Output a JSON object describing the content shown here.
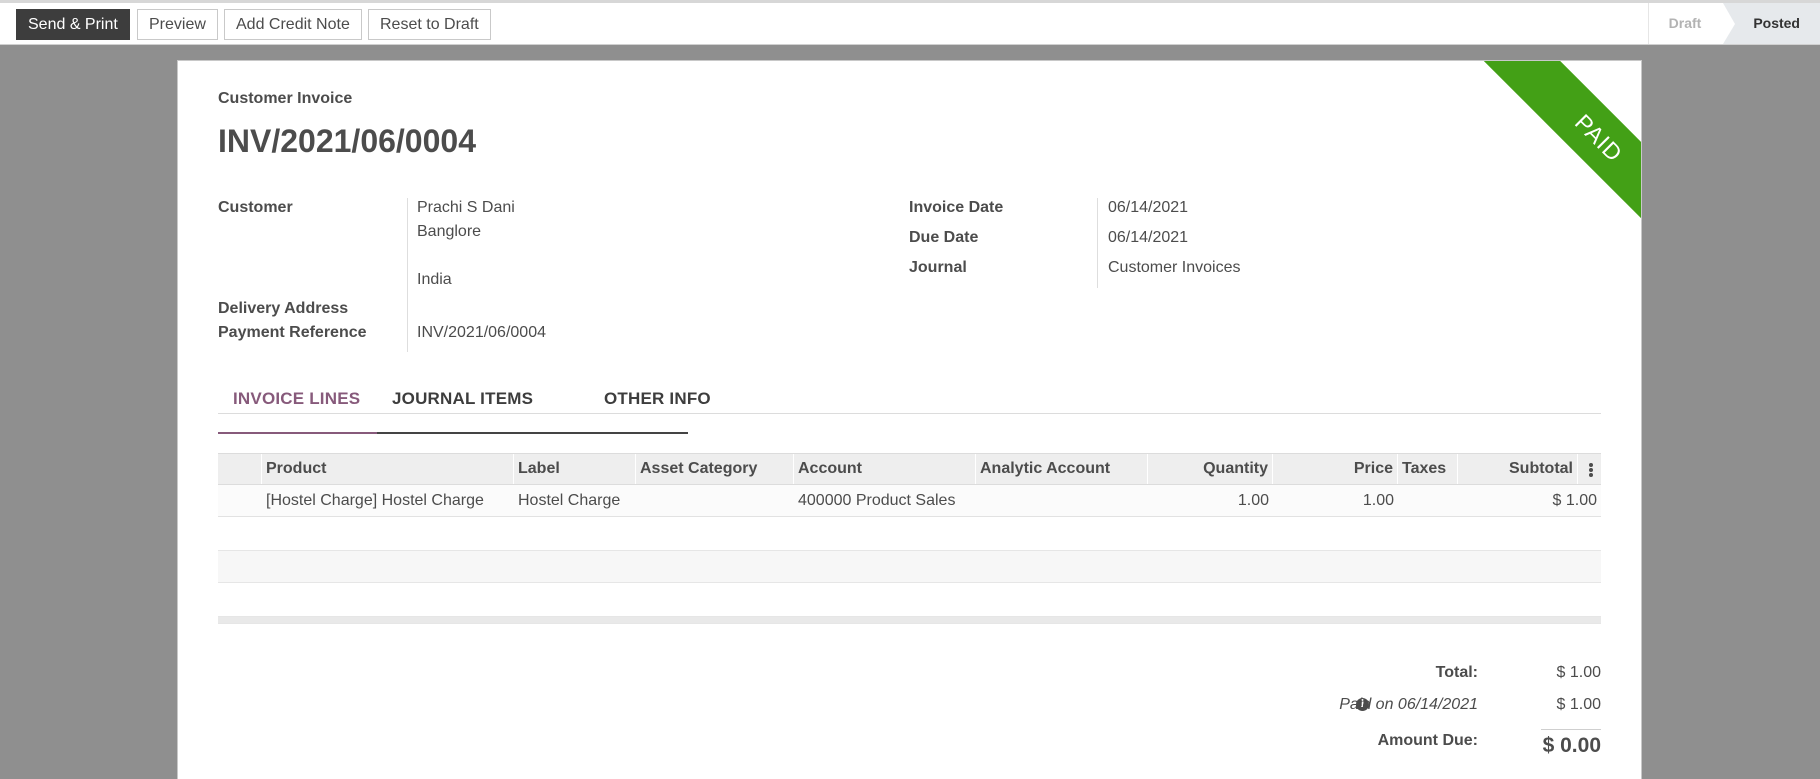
{
  "toolbar": {
    "send_print": "Send & Print",
    "preview": "Preview",
    "add_credit_note": "Add Credit Note",
    "reset_to_draft": "Reset to Draft"
  },
  "status": {
    "stages": [
      "Draft",
      "Posted"
    ],
    "current": "Posted"
  },
  "ribbon": {
    "text": "PAID",
    "color": "#43a016"
  },
  "invoice": {
    "kind": "Customer Invoice",
    "number": "INV/2021/06/0004",
    "customer_label": "Customer",
    "customer_name": "Prachi S Dani",
    "customer_city": "Banglore",
    "customer_country": "India",
    "delivery_address_label": "Delivery Address",
    "payment_reference_label": "Payment Reference",
    "payment_reference": "INV/2021/06/0004",
    "invoice_date_label": "Invoice Date",
    "invoice_date": "06/14/2021",
    "due_date_label": "Due Date",
    "due_date": "06/14/2021",
    "journal_label": "Journal",
    "journal": "Customer Invoices"
  },
  "tabs": [
    {
      "label": "INVOICE LINES",
      "active": true
    },
    {
      "label": "JOURNAL ITEMS",
      "active": false
    },
    {
      "label": "OTHER INFO",
      "active": false
    }
  ],
  "lines": {
    "columns": [
      "Product",
      "Label",
      "Asset Category",
      "Account",
      "Analytic Account",
      "Quantity",
      "Price",
      "Taxes",
      "Subtotal"
    ],
    "rows": [
      {
        "product": "[Hostel Charge] Hostel Charge",
        "label": "Hostel Charge",
        "asset_category": "",
        "account": "400000 Product Sales",
        "analytic_account": "",
        "quantity": "1.00",
        "price": "1.00",
        "taxes": "",
        "subtotal": "$ 1.00"
      }
    ]
  },
  "totals": {
    "total_label": "Total:",
    "total_value": "$ 1.00",
    "paid_on_label": "Paid on 06/14/2021",
    "paid_on_value": "$ 1.00",
    "amount_due_label": "Amount Due:",
    "amount_due_value": "$ 0.00"
  },
  "colors": {
    "accent": "#875a7b",
    "primary_button": "#3d3d3d",
    "paid_ribbon": "#43a016",
    "background": "#8f8f8f"
  }
}
